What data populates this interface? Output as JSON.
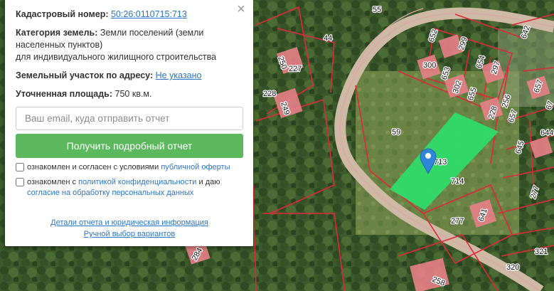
{
  "panel": {
    "cadastral_label": "Кадастровый номер:",
    "cadastral_number": "50:26:0110715:713",
    "category_label": "Категория земель:",
    "category_value_1": "Земли поселений (земли",
    "category_value_2": "населенных пунктов)",
    "category_value_3": "для индивидуального жилищного строительства",
    "address_label": "Земельный участок по адресу:",
    "address_value": "Не указано",
    "area_label": "Уточненная площадь:",
    "area_value": "750 кв.м.",
    "email_placeholder": "Ваш email, куда отправить отчет",
    "submit_label": "Получить подробный отчет",
    "consent1_prefix": "ознакомлен и согласен с условиями ",
    "consent1_link": "публичной оферты",
    "consent2_prefix": "ознакомлен с ",
    "consent2_link1": "политикой конфиденциальности",
    "consent2_middle": " и даю",
    "consent2_link2": "согласие на обработку персональных данных",
    "details_link": "Детали отчета и юридическая информация",
    "manual_link": "Ручной выбор вариантов",
    "close_glyph": "×"
  },
  "map": {
    "selected_plot_fill": "#2ee06a",
    "plot_border_color": "#e0283a",
    "building_color": "#e88088",
    "road_color": "#d9a8a4",
    "pin_color": "#2f86d8",
    "plot_numbers": [
      "55",
      "44",
      "250",
      "227",
      "228",
      "249",
      "652",
      "299",
      "300",
      "653",
      "654",
      "297",
      "302",
      "655",
      "256",
      "228",
      "657",
      "642",
      "657",
      "67",
      "644",
      "59",
      "645",
      "714",
      "277",
      "641",
      "277",
      "321",
      "320",
      "258",
      "284",
      "713"
    ]
  }
}
